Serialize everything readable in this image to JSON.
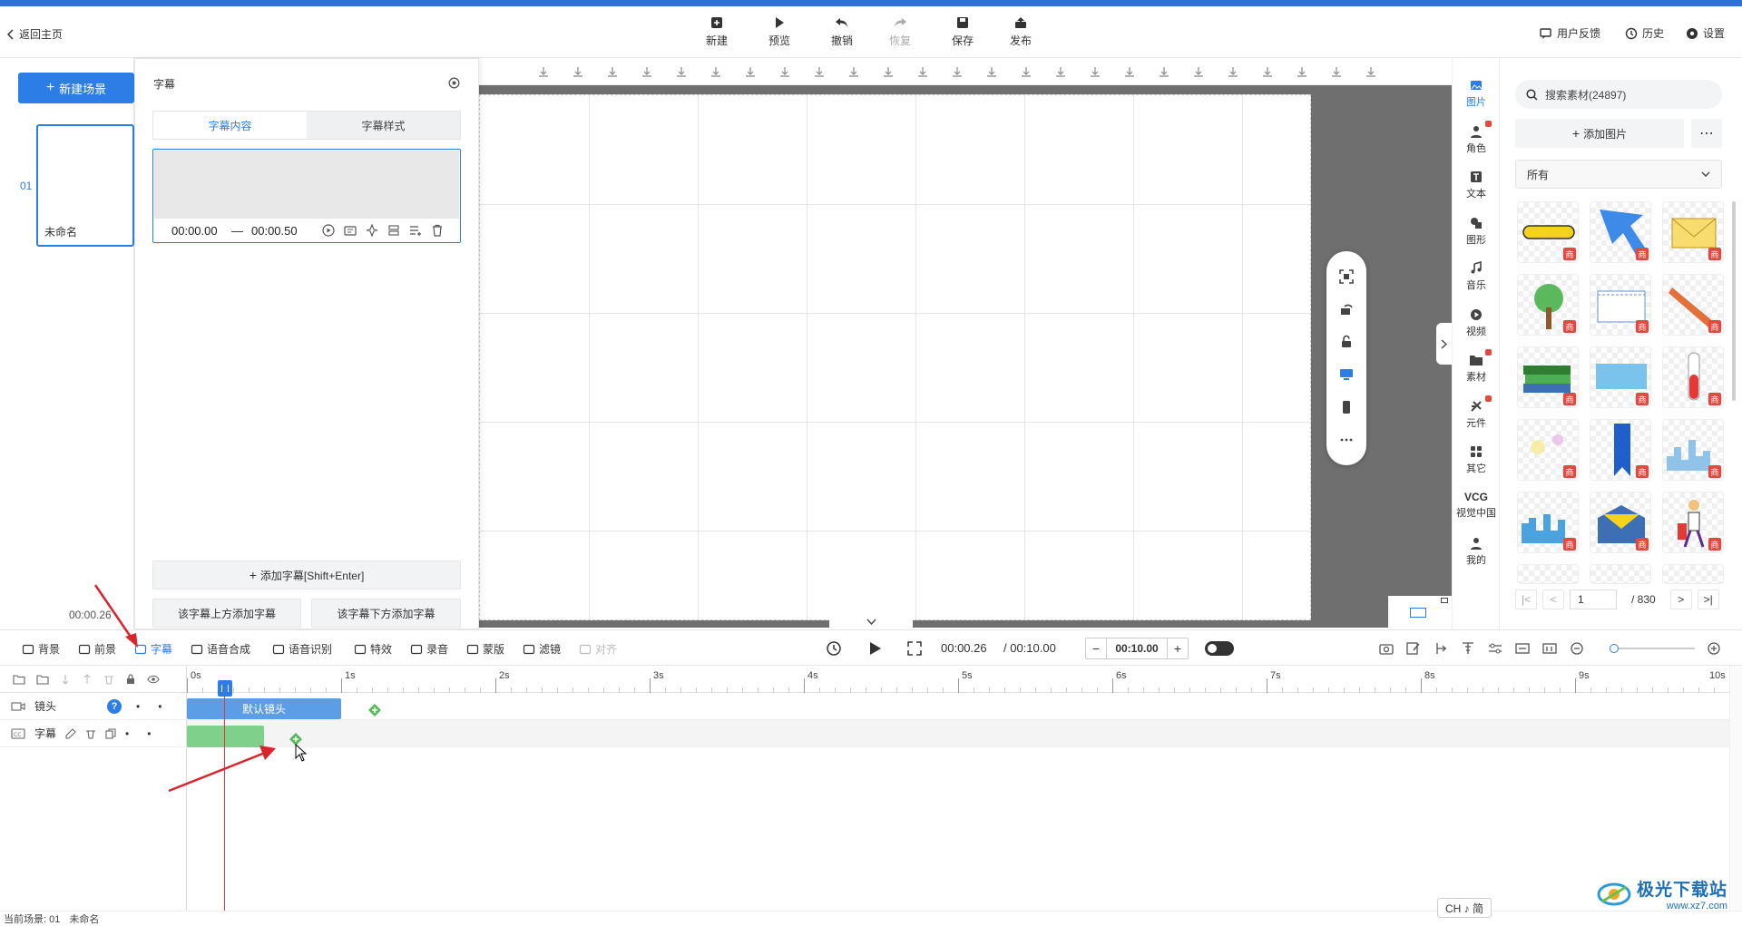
{
  "colors": {
    "accent": "#2d7de6",
    "topbar": "#2f6fd8",
    "subtitle_clip": "#7ed08a",
    "scene_clip": "#5b9ee6",
    "playhead": "#e53935",
    "arrow": "#d9232d"
  },
  "toolbar": {
    "back": "返回主页",
    "actions": [
      {
        "label": "新建",
        "icon": "new-icon"
      },
      {
        "label": "预览",
        "icon": "play-icon"
      },
      {
        "label": "撤销",
        "icon": "undo-icon"
      },
      {
        "label": "恢复",
        "icon": "redo-icon",
        "disabled": true
      },
      {
        "label": "保存",
        "icon": "save-icon"
      },
      {
        "label": "发布",
        "icon": "publish-icon"
      }
    ],
    "right": [
      {
        "label": "用户反馈",
        "icon": "feedback-icon"
      },
      {
        "label": "历史",
        "icon": "history-icon"
      },
      {
        "label": "设置",
        "icon": "gear-icon"
      }
    ]
  },
  "scenes": {
    "new_scene": "新建场景",
    "number": "01",
    "name": "未命名",
    "time": "00:00.26"
  },
  "subtitle_panel": {
    "title": "字幕",
    "tabs": [
      "字幕内容",
      "字幕样式"
    ],
    "entry": {
      "start": "00:00.00",
      "dash": "—",
      "end": "00:00.50"
    },
    "add_button": "添加字幕[Shift+Enter]",
    "add_above": "该字幕上方添加字幕",
    "add_below": "该字幕下方添加字幕"
  },
  "right_categories": [
    {
      "label": "图片",
      "icon": "image-icon",
      "active": true
    },
    {
      "label": "角色",
      "icon": "character-icon",
      "dot": true
    },
    {
      "label": "文本",
      "icon": "text-icon"
    },
    {
      "label": "图形",
      "icon": "shape-icon"
    },
    {
      "label": "音乐",
      "icon": "music-icon"
    },
    {
      "label": "视频",
      "icon": "video-icon"
    },
    {
      "label": "素材",
      "icon": "folder-icon",
      "dot": true
    },
    {
      "label": "元件",
      "icon": "component-icon",
      "dot": true
    },
    {
      "label": "其它",
      "icon": "grid-icon"
    },
    {
      "label": "视觉中国",
      "icon": "vcg-icon",
      "top": "VCG"
    },
    {
      "label": "我的",
      "icon": "user-icon"
    }
  ],
  "assets": {
    "search_placeholder": "搜索素材(24897)",
    "add_image": "添加图片",
    "filter": "所有",
    "badge": "商",
    "items": [
      "yellow-bar",
      "blue-arrow",
      "envelope",
      "tree",
      "notepad",
      "pencil",
      "books",
      "blue-rect",
      "test-tube",
      "sparkles",
      "bookmark",
      "city-skyline",
      "city-skyline-2",
      "open-envelope",
      "traveler"
    ],
    "page": "1",
    "total": "/ 830"
  },
  "timeline_toolbar": {
    "items": [
      {
        "label": "背景",
        "icon": "background-icon"
      },
      {
        "label": "前景",
        "icon": "foreground-icon"
      },
      {
        "label": "字幕",
        "icon": "subtitle-icon",
        "active": true
      },
      {
        "label": "语音合成",
        "icon": "tts-icon"
      },
      {
        "label": "语音识别",
        "icon": "asr-icon"
      },
      {
        "label": "特效",
        "icon": "effects-icon"
      },
      {
        "label": "录音",
        "icon": "record-icon"
      },
      {
        "label": "蒙版",
        "icon": "mask-icon"
      },
      {
        "label": "滤镜",
        "icon": "filter-icon"
      },
      {
        "label": "对齐",
        "icon": "align-icon",
        "disabled": true
      }
    ],
    "current_time": "00:00.26",
    "total_time": "/ 00:10.00",
    "duration": "00:10.00"
  },
  "ruler": {
    "ticks": [
      "0s",
      "1s",
      "2s",
      "3s",
      "4s",
      "5s",
      "6s",
      "7s",
      "8s",
      "9s",
      "10s"
    ]
  },
  "tracks": [
    {
      "label": "镜头",
      "clip": "默认镜头"
    },
    {
      "label": "字幕",
      "clip": ""
    }
  ],
  "statusbar": {
    "scene": "当前场景: 01",
    "name": "未命名"
  },
  "ime": "CH ♪ 简",
  "watermark": {
    "brand": "极光下载站",
    "url": "www.xz7.com"
  }
}
